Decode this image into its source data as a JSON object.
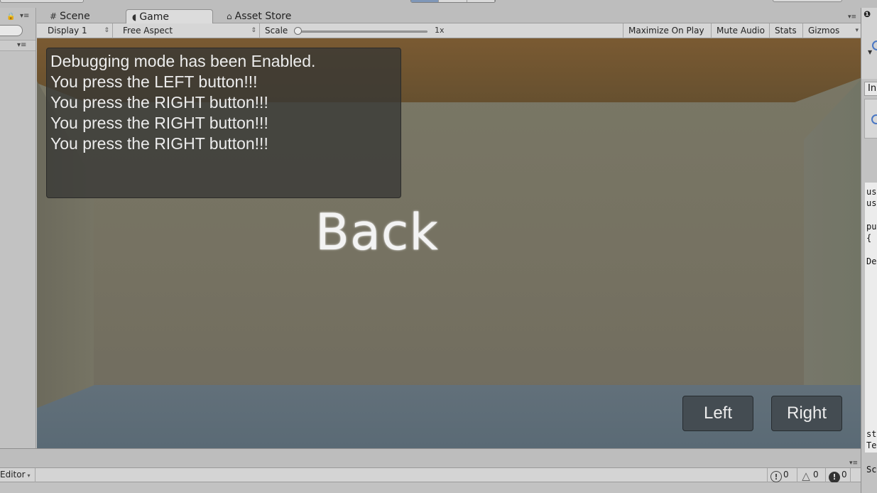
{
  "tabs": {
    "scene": {
      "icon": "grid-icon",
      "label": "Scene"
    },
    "game": {
      "icon": "game-controller-icon",
      "label": "Game"
    },
    "asset_store": {
      "icon": "shopping-bag-icon",
      "label": "Asset Store"
    }
  },
  "game_toolbar": {
    "display": "Display 1",
    "aspect": "Free Aspect",
    "scale_label": "Scale",
    "scale_value": "1x",
    "maximize_on_play": "Maximize On Play",
    "mute_audio": "Mute Audio",
    "stats": "Stats",
    "gizmos": "Gizmos"
  },
  "game_view": {
    "debug_lines": [
      "Debugging mode has been Enabled.",
      "You press the LEFT button!!!",
      "You press the RIGHT button!!!",
      "You press the RIGHT button!!!",
      "You press the RIGHT button!!!"
    ],
    "back_label": "Back",
    "left_button": "Left",
    "right_button": "Right",
    "colors": {
      "ceiling": "#6e5230",
      "walls": "#737060",
      "floor": "#5e6c77",
      "button_bg": "#444c52"
    }
  },
  "right_panel": {
    "field_text": "In",
    "code_lines": [
      "us",
      "us",
      "pu",
      "{",
      "De",
      "sty",
      "Te",
      "Sc"
    ]
  },
  "console": {
    "editor_label": "Editor",
    "log_count": "0",
    "warning_count": "0",
    "error_count": "0"
  }
}
